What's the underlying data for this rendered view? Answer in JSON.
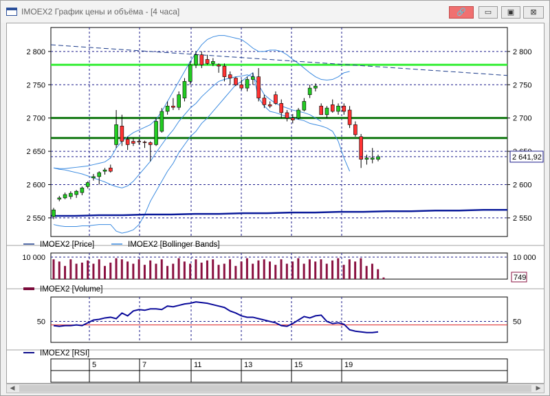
{
  "window": {
    "title": "IMOEX2 График цены и объёма - [4 часа]",
    "buttons": {
      "pin": "🔗",
      "minimize": "▭",
      "maximize": "▣",
      "close": "⊠"
    }
  },
  "price_panel": {
    "y_ticks": [
      2550,
      2600,
      2650,
      2700,
      2750,
      2800
    ],
    "y_tick_labels": [
      "2 550",
      "2 600",
      "2 650",
      "2 700",
      "2 750",
      "2 800"
    ],
    "ylim": [
      2522,
      2836
    ],
    "last_price_label": "2 641,92",
    "last_price": 2641.92,
    "horizontal_levels": [
      {
        "value": 2780,
        "color": "#33ee33"
      },
      {
        "value": 2700,
        "color": "#117711"
      },
      {
        "value": 2670,
        "color": "#117711"
      }
    ],
    "legend": [
      {
        "label": "IMOEX2 [Price]",
        "color": "#1a3a8a"
      },
      {
        "label": "IMOEX2 [Bollinger Bands]",
        "color": "#3a8ae0"
      }
    ]
  },
  "volume_panel": {
    "y_tick_labels": [
      "10 000",
      "10 000"
    ],
    "last_volume_label": "749",
    "legend": [
      {
        "label": "IMOEX2 [Volume]",
        "color": "#7a0a3a"
      }
    ]
  },
  "rsi_panel": {
    "y_tick_labels": [
      "50",
      "50"
    ],
    "legend": [
      {
        "label": "IMOEX2 [RSI]",
        "color": "#0a0a8a"
      }
    ]
  },
  "x_axis": {
    "tick_labels": [
      "5",
      "7",
      "11",
      "13",
      "15",
      "19"
    ]
  },
  "chart_data": {
    "type": "candlestick",
    "candles": [
      {
        "o": 2552,
        "h": 2565,
        "l": 2548,
        "c": 2562
      },
      {
        "o": 2578,
        "h": 2583,
        "l": 2575,
        "c": 2580
      },
      {
        "o": 2580,
        "h": 2588,
        "l": 2578,
        "c": 2585
      },
      {
        "o": 2582,
        "h": 2590,
        "l": 2578,
        "c": 2587
      },
      {
        "o": 2585,
        "h": 2592,
        "l": 2580,
        "c": 2590
      },
      {
        "o": 2588,
        "h": 2597,
        "l": 2584,
        "c": 2595
      },
      {
        "o": 2597,
        "h": 2605,
        "l": 2594,
        "c": 2603
      },
      {
        "o": 2610,
        "h": 2616,
        "l": 2606,
        "c": 2612
      },
      {
        "o": 2612,
        "h": 2620,
        "l": 2600,
        "c": 2618
      },
      {
        "o": 2620,
        "h": 2625,
        "l": 2615,
        "c": 2622
      },
      {
        "o": 2625,
        "h": 2630,
        "l": 2618,
        "c": 2620
      },
      {
        "o": 2660,
        "h": 2712,
        "l": 2655,
        "c": 2690
      },
      {
        "o": 2688,
        "h": 2705,
        "l": 2658,
        "c": 2665
      },
      {
        "o": 2668,
        "h": 2672,
        "l": 2652,
        "c": 2660
      },
      {
        "o": 2665,
        "h": 2670,
        "l": 2658,
        "c": 2662
      },
      {
        "o": 2665,
        "h": 2668,
        "l": 2660,
        "c": 2664
      },
      {
        "o": 2664,
        "h": 2666,
        "l": 2655,
        "c": 2663
      },
      {
        "o": 2663,
        "h": 2665,
        "l": 2635,
        "c": 2660
      },
      {
        "o": 2660,
        "h": 2700,
        "l": 2658,
        "c": 2695
      },
      {
        "o": 2680,
        "h": 2715,
        "l": 2678,
        "c": 2710
      },
      {
        "o": 2710,
        "h": 2725,
        "l": 2705,
        "c": 2718
      },
      {
        "o": 2718,
        "h": 2730,
        "l": 2712,
        "c": 2716
      },
      {
        "o": 2716,
        "h": 2740,
        "l": 2712,
        "c": 2735
      },
      {
        "o": 2730,
        "h": 2760,
        "l": 2725,
        "c": 2755
      },
      {
        "o": 2755,
        "h": 2785,
        "l": 2750,
        "c": 2780
      },
      {
        "o": 2780,
        "h": 2800,
        "l": 2775,
        "c": 2795
      },
      {
        "o": 2795,
        "h": 2800,
        "l": 2775,
        "c": 2780
      },
      {
        "o": 2788,
        "h": 2795,
        "l": 2780,
        "c": 2782
      },
      {
        "o": 2782,
        "h": 2790,
        "l": 2778,
        "c": 2785
      },
      {
        "o": 2780,
        "h": 2782,
        "l": 2768,
        "c": 2778
      },
      {
        "o": 2778,
        "h": 2782,
        "l": 2755,
        "c": 2762
      },
      {
        "o": 2765,
        "h": 2770,
        "l": 2750,
        "c": 2760
      },
      {
        "o": 2760,
        "h": 2762,
        "l": 2748,
        "c": 2750
      },
      {
        "o": 2750,
        "h": 2758,
        "l": 2742,
        "c": 2745
      },
      {
        "o": 2745,
        "h": 2762,
        "l": 2740,
        "c": 2758
      },
      {
        "o": 2758,
        "h": 2768,
        "l": 2750,
        "c": 2762
      },
      {
        "o": 2762,
        "h": 2775,
        "l": 2725,
        "c": 2730
      },
      {
        "o": 2730,
        "h": 2735,
        "l": 2715,
        "c": 2720
      },
      {
        "o": 2720,
        "h": 2725,
        "l": 2715,
        "c": 2718
      },
      {
        "o": 2735,
        "h": 2740,
        "l": 2720,
        "c": 2722
      },
      {
        "o": 2722,
        "h": 2728,
        "l": 2700,
        "c": 2708
      },
      {
        "o": 2708,
        "h": 2712,
        "l": 2695,
        "c": 2700
      },
      {
        "o": 2700,
        "h": 2706,
        "l": 2692,
        "c": 2697
      },
      {
        "o": 2700,
        "h": 2715,
        "l": 2698,
        "c": 2712
      },
      {
        "o": 2712,
        "h": 2730,
        "l": 2710,
        "c": 2725
      },
      {
        "o": 2735,
        "h": 2750,
        "l": 2730,
        "c": 2745
      },
      {
        "o": 2745,
        "h": 2752,
        "l": 2740,
        "c": 2748
      },
      {
        "o": 2718,
        "h": 2722,
        "l": 2705,
        "c": 2705
      },
      {
        "o": 2705,
        "h": 2718,
        "l": 2700,
        "c": 2715
      },
      {
        "o": 2720,
        "h": 2728,
        "l": 2708,
        "c": 2710
      },
      {
        "o": 2710,
        "h": 2722,
        "l": 2705,
        "c": 2718
      },
      {
        "o": 2718,
        "h": 2722,
        "l": 2705,
        "c": 2710
      },
      {
        "o": 2712,
        "h": 2718,
        "l": 2685,
        "c": 2690
      },
      {
        "o": 2690,
        "h": 2695,
        "l": 2672,
        "c": 2675
      },
      {
        "o": 2672,
        "h": 2676,
        "l": 2625,
        "c": 2638
      },
      {
        "o": 2638,
        "h": 2645,
        "l": 2630,
        "c": 2640
      },
      {
        "o": 2638,
        "h": 2655,
        "l": 2632,
        "c": 2640
      },
      {
        "o": 2638,
        "h": 2645,
        "l": 2635,
        "c": 2642
      }
    ],
    "bollinger_upper": [
      2625,
      2624,
      2624,
      2625,
      2626,
      2627,
      2628,
      2630,
      2632,
      2634,
      2640,
      2655,
      2665,
      2672,
      2678,
      2682,
      2686,
      2690,
      2698,
      2710,
      2725,
      2740,
      2755,
      2770,
      2785,
      2798,
      2810,
      2818,
      2822,
      2824,
      2824,
      2822,
      2820,
      2818,
      2812,
      2805,
      2800,
      2800,
      2802,
      2802,
      2800,
      2795,
      2788,
      2782,
      2775,
      2768,
      2762,
      2758,
      2757,
      2758,
      2762,
      2768,
      2770
    ],
    "bollinger_lower": [
      2540,
      2538,
      2537,
      2537,
      2537,
      2538,
      2538,
      2539,
      2540,
      2540,
      2540,
      2530,
      2527,
      2529,
      2532,
      2540,
      2555,
      2575,
      2590,
      2605,
      2620,
      2632,
      2648,
      2660,
      2672,
      2680,
      2692,
      2700,
      2710,
      2720,
      2730,
      2740,
      2750,
      2755,
      2762,
      2768,
      2730,
      2718,
      2710,
      2708,
      2705,
      2702,
      2700,
      2698,
      2696,
      2692,
      2690,
      2688,
      2685,
      2680,
      2665,
      2640,
      2620
    ],
    "bollinger_mid": [
      2625,
      2623,
      2622,
      2620,
      2618,
      2616,
      2613,
      2610,
      2607,
      2604,
      2600,
      2597,
      2595,
      2598,
      2605,
      2615,
      2625,
      2635,
      2648,
      2660,
      2672,
      2682,
      2695,
      2705,
      2715,
      2722,
      2732,
      2740,
      2748,
      2755,
      2758,
      2760,
      2762,
      2763,
      2765,
      2762,
      2750,
      2735,
      2728,
      2722,
      2718,
      2715,
      2712,
      2710,
      2708,
      2705,
      2700,
      2695
    ],
    "moving_average_long": [
      2810,
      2808,
      2806,
      2804,
      2802,
      2800,
      2798,
      2796,
      2794,
      2792,
      2790,
      2788,
      2786,
      2784,
      2782,
      2780,
      2778,
      2776,
      2774,
      2772,
      2770,
      2768,
      2766,
      2764
    ],
    "moving_average_floor": [
      2553,
      2553,
      2554,
      2554,
      2555,
      2555,
      2556,
      2556,
      2557,
      2557,
      2558,
      2558,
      2559,
      2559,
      2560,
      2560,
      2561,
      2561,
      2562,
      2562
    ],
    "volume": [
      9000,
      8000,
      6000,
      9000,
      7000,
      7500,
      8500,
      7000,
      9000,
      6000,
      7500,
      9500,
      9000,
      8000,
      7000,
      9000,
      6500,
      8500,
      7000,
      9000,
      6000,
      7000,
      9500,
      8000,
      7000,
      9000,
      7500,
      8500,
      9000,
      6500,
      7000,
      9000,
      6000,
      8000,
      9500,
      7000,
      8500,
      9000,
      8000,
      6500,
      9000,
      7000,
      8000,
      9500,
      7000,
      9000,
      8000,
      9000,
      7000,
      8500,
      9500,
      6500,
      9000,
      8000,
      9500,
      6000,
      7000,
      4500,
      749
    ],
    "rsi": [
      44,
      43,
      44,
      44,
      45,
      44,
      48,
      52,
      53,
      55,
      56,
      54,
      62,
      58,
      65,
      67,
      66,
      68,
      68,
      67,
      72,
      71,
      73,
      75,
      76,
      78,
      77,
      76,
      74,
      72,
      70,
      65,
      62,
      58,
      56,
      56,
      54,
      52,
      50,
      48,
      44,
      43,
      47,
      52,
      57,
      55,
      58,
      59,
      50,
      47,
      48,
      46,
      38,
      36,
      35,
      34,
      34,
      35
    ]
  }
}
